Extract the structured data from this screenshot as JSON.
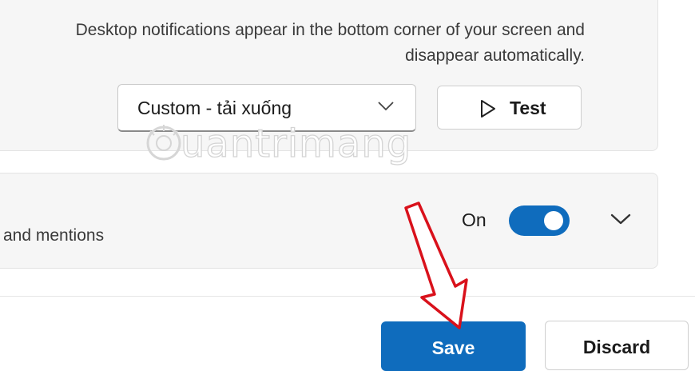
{
  "notifications": {
    "description": "Desktop notifications appear in the bottom corner of your screen and disappear automatically.",
    "sound_dropdown": {
      "value": "Custom - tải xuống"
    },
    "test_button": {
      "label": "Test"
    }
  },
  "watermark": {
    "text": "uantrimang"
  },
  "mentions_row": {
    "label": "and mentions",
    "toggle_label": "On",
    "toggle_on": true
  },
  "footer": {
    "save_label": "Save",
    "discard_label": "Discard"
  },
  "colors": {
    "accent": "#0f6cbd",
    "arrow": "#d9111b"
  }
}
